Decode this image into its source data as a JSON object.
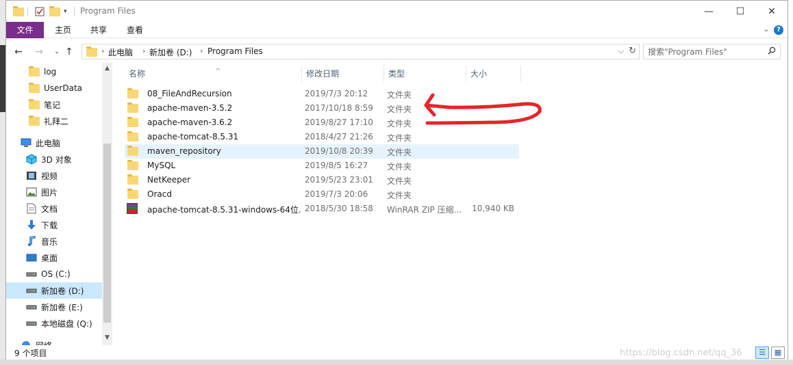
{
  "window": {
    "title": "Program Files"
  },
  "title_controls": {
    "minimize": "—",
    "maximize": "☐",
    "close": "✕"
  },
  "ribbon": {
    "tabs": [
      "文件",
      "主页",
      "共享",
      "查看"
    ],
    "help": "?"
  },
  "address": {
    "breadcrumbs": [
      "此电脑",
      "新加卷 (D:)",
      "Program Files"
    ],
    "search_placeholder": "搜索\"Program Files\""
  },
  "nav": {
    "items": [
      {
        "label": "log",
        "icon": "folder-icon"
      },
      {
        "label": "UserData",
        "icon": "folder-icon"
      },
      {
        "label": "笔记",
        "icon": "folder-icon"
      },
      {
        "label": "礼拜二",
        "icon": "folder-icon"
      },
      {
        "label": "此电脑",
        "icon": "computer-icon"
      },
      {
        "label": "3D 对象",
        "icon": "cube-icon"
      },
      {
        "label": "视频",
        "icon": "video-icon"
      },
      {
        "label": "图片",
        "icon": "picture-icon"
      },
      {
        "label": "文档",
        "icon": "document-icon"
      },
      {
        "label": "下载",
        "icon": "download-icon"
      },
      {
        "label": "音乐",
        "icon": "music-icon"
      },
      {
        "label": "桌面",
        "icon": "desktop-icon"
      },
      {
        "label": "OS (C:)",
        "icon": "drive-icon"
      },
      {
        "label": "新加卷 (D:)",
        "icon": "drive-icon"
      },
      {
        "label": "新加卷 (E:)",
        "icon": "drive-icon"
      },
      {
        "label": "本地磁盘 (Q:)",
        "icon": "drive-icon"
      },
      {
        "label": "网络",
        "icon": "network-icon"
      }
    ],
    "selected": "新加卷 (D:)"
  },
  "columns": {
    "name": "名称",
    "date": "修改日期",
    "type": "类型",
    "size": "大小"
  },
  "files": [
    {
      "name": "08_FileAndRecursion",
      "date": "2019/7/3 20:12",
      "type": "文件夹",
      "size": ""
    },
    {
      "name": "apache-maven-3.5.2",
      "date": "2017/10/18 8:59",
      "type": "文件夹",
      "size": ""
    },
    {
      "name": "apache-maven-3.6.2",
      "date": "2019/8/27 17:10",
      "type": "文件夹",
      "size": ""
    },
    {
      "name": "apache-tomcat-8.5.31",
      "date": "2018/4/27 21:26",
      "type": "文件夹",
      "size": ""
    },
    {
      "name": "maven_repository",
      "date": "2019/10/8 20:39",
      "type": "文件夹",
      "size": ""
    },
    {
      "name": "MySQL",
      "date": "2019/8/5 16:27",
      "type": "文件夹",
      "size": ""
    },
    {
      "name": "NetKeeper",
      "date": "2019/5/23 23:01",
      "type": "文件夹",
      "size": ""
    },
    {
      "name": "Oracd",
      "date": "2019/7/3 20:06",
      "type": "文件夹",
      "size": ""
    },
    {
      "name": "apache-tomcat-8.5.31-windows-64位...",
      "date": "2018/5/30 18:58",
      "type": "WinRAR ZIP 压缩...",
      "size": "10,940 KB"
    }
  ],
  "status": {
    "count": "9 个项目"
  },
  "watermark": "https://blog.csdn.net/qq_36",
  "colors": {
    "file_tab": "#7a2d8a",
    "selection": "#cce8ff",
    "hover": "#e5f3ff",
    "folder": "#f8d775",
    "annotation": "#e8242b"
  }
}
